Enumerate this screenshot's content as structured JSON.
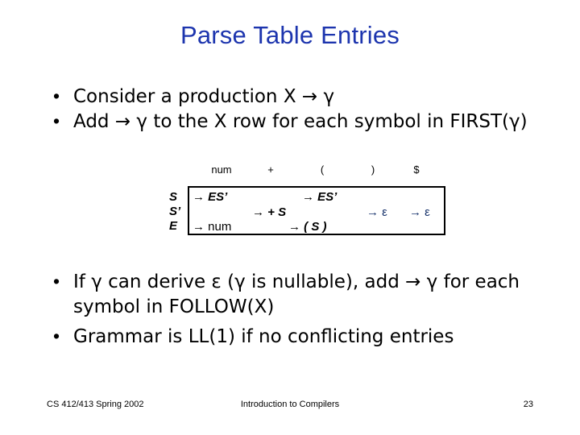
{
  "slide": {
    "title": "Parse Table Entries",
    "bullet_char": "•"
  },
  "bullets_top": [
    {
      "text": "Consider a production X → γ"
    },
    {
      "text": "Add → γ to the X row for each symbol in FIRST(γ)"
    }
  ],
  "bullets_bottom": [
    {
      "text": "If  γ  can derive  ε  (γ is nullable), add → γ  for each symbol in FOLLOW(X)"
    },
    {
      "text": "Grammar is LL(1) if no conflicting entries"
    }
  ],
  "parse_table": {
    "columns": [
      "num",
      "+",
      "(",
      ")",
      "$"
    ],
    "rows": [
      "S",
      "S’",
      "E"
    ],
    "cells": [
      {
        "row": "S",
        "col": "num",
        "text": "→ ES’"
      },
      {
        "row": "S",
        "col": "(",
        "text": "→ ES’"
      },
      {
        "row": "S’",
        "col": "+",
        "text": "→ + S"
      },
      {
        "row": "S’",
        "col": ")",
        "text": "→ ε"
      },
      {
        "row": "S’",
        "col": "$",
        "text": "→ ε"
      },
      {
        "row": "E",
        "col": "num",
        "text": "→ num"
      },
      {
        "row": "E",
        "col": "(",
        "text": "→ ( S )"
      }
    ]
  },
  "footer": {
    "left": "CS 412/413   Spring 2002",
    "center": "Introduction to Compilers",
    "page": "23"
  },
  "colors": {
    "title": "#1d35ae",
    "epsilon": "#17326b",
    "text": "#000000",
    "background": "#ffffff"
  }
}
